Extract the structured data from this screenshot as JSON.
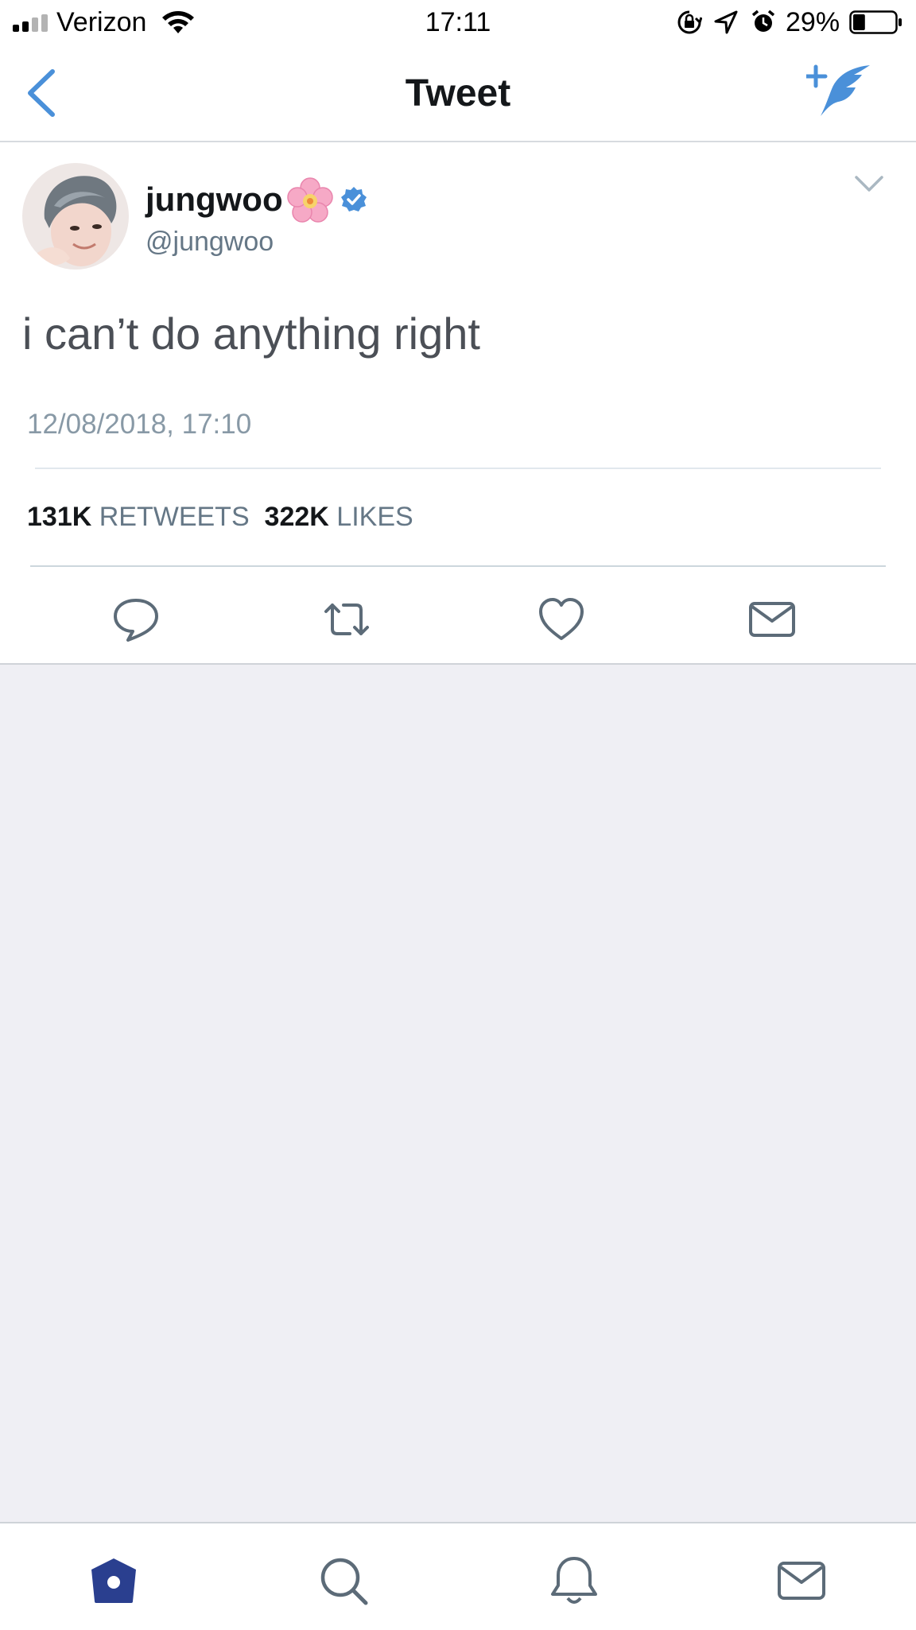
{
  "status_bar": {
    "carrier": "Verizon",
    "time": "17:11",
    "battery_percent": "29%",
    "battery_level": 0.29
  },
  "nav": {
    "title": "Tweet"
  },
  "tweet": {
    "display_name": "jungwoo",
    "handle": "@jungwoo",
    "text": "i can’t do anything right",
    "timestamp": "12/08/2018, 17:10",
    "retweets_count": "131K",
    "retweets_label": "RETWEETS",
    "likes_count": "322K",
    "likes_label": "LIKES",
    "verified": true
  },
  "colors": {
    "accent": "#4a90d9",
    "tab_active": "#2a3f8f",
    "feed_bg": "#efeff4"
  },
  "icons": {
    "nav": [
      "back-chevron-icon",
      "compose-tweet-icon"
    ],
    "actions": [
      "reply-icon",
      "retweet-icon",
      "like-icon",
      "direct-message-icon"
    ],
    "tabs": [
      "home-icon",
      "search-icon",
      "notifications-icon",
      "messages-icon"
    ]
  }
}
